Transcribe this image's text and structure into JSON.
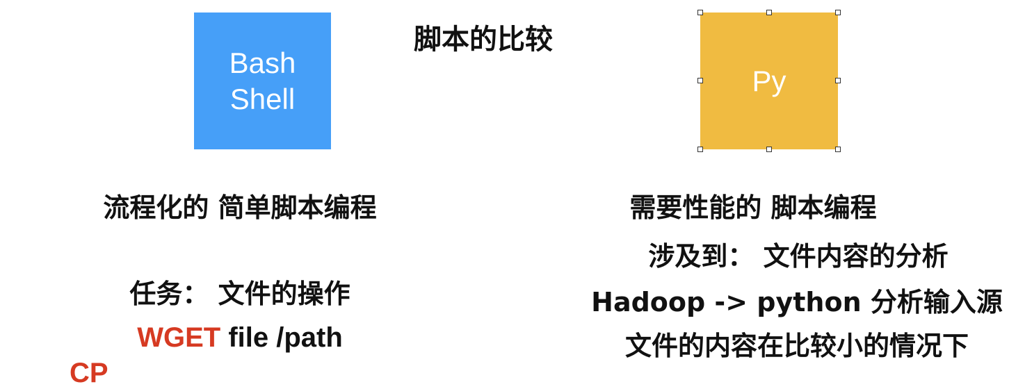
{
  "slide": {
    "title": "脚本的比较",
    "bash_box": {
      "line1": "Bash",
      "line2": "Shell",
      "color": "#469ff8"
    },
    "py_box": {
      "label": "Py",
      "color": "#f0bb41"
    },
    "left_column": {
      "heading": "流程化的 简单脚本编程",
      "task": "任务：  文件的操作",
      "cmd1_keyword": "WGET",
      "cmd1_rest": " file /path",
      "cmd2_keyword": "CP",
      "accent_color": "#d63a22"
    },
    "right_column": {
      "heading": "需要性能的 脚本编程",
      "line1": "涉及到：  文件内容的分析",
      "line2": "Hadoop -> python 分析输入源",
      "line3": "文件的内容在比较小的情况下"
    }
  }
}
